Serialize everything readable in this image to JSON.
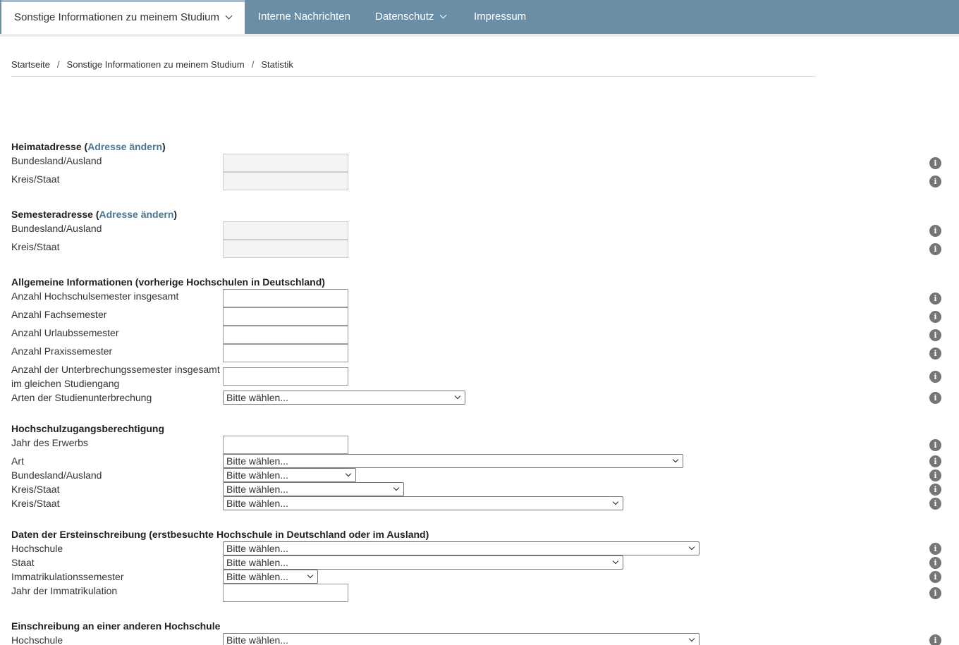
{
  "nav": {
    "items": [
      {
        "label": "Sonstige Informationen zu meinem Studium",
        "has_dropdown": true,
        "active": true
      },
      {
        "label": "Interne Nachrichten",
        "has_dropdown": false
      },
      {
        "label": "Datenschutz",
        "has_dropdown": true
      },
      {
        "label": "Impressum",
        "has_dropdown": false
      }
    ]
  },
  "breadcrumb": [
    "Startseite",
    "/",
    "Sonstige Informationen zu meinem Studium",
    "/",
    "Statistik"
  ],
  "sections": {
    "heimat": {
      "title": "Heimatadresse",
      "link": "Adresse ändern",
      "open": "(",
      "close": ")",
      "fields": [
        "Bundesland/Ausland",
        "Kreis/Staat"
      ]
    },
    "semester": {
      "title": "Semesteradresse",
      "link": "Adresse ändern",
      "open": "(",
      "close": ")",
      "fields": [
        "Bundesland/Ausland",
        "Kreis/Staat"
      ]
    },
    "allgemein": {
      "title": "Allgemeine Informationen (vorherige Hochschulen in Deutschland)",
      "fields": [
        "Anzahl Hochschulsemester insgesamt",
        "Anzahl Fachsemester",
        "Anzahl Urlaubssemester",
        "Anzahl Praxissemester",
        "Anzahl der Unterbrechungssemester insgesamt",
        "im gleichen Studiengang",
        "Arten der Studienunterbrechung"
      ]
    },
    "hzb": {
      "title": "Hochschulzugangsberechtigung",
      "fields": [
        "Jahr des Erwerbs",
        "Art",
        "Bundesland/Ausland",
        "Kreis/Staat",
        "Kreis/Staat"
      ]
    },
    "erst": {
      "title": "Daten der Ersteinschreibung (erstbesuchte Hochschule in Deutschland oder im Ausland)",
      "fields": [
        "Hochschule",
        "Staat",
        "Immatrikulationssemester",
        "Jahr der Immatrikulation"
      ]
    },
    "andere": {
      "title": "Einschreibung an einer anderen Hochschule",
      "fields": [
        "Hochschule"
      ]
    }
  },
  "select_placeholder": "Bitte wählen...",
  "info_glyph": "i",
  "icons": {
    "info": "info-icon",
    "dropdown": "chevron-down-icon"
  },
  "colors": {
    "nav_bg": "#6a8ea6",
    "link": "#4c7592",
    "info_icon": "#757575"
  }
}
